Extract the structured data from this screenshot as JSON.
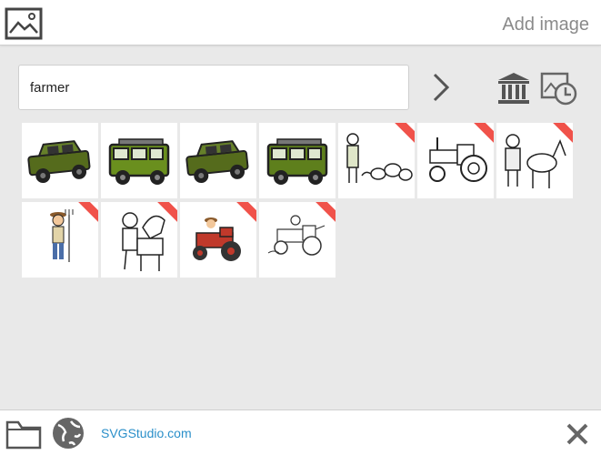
{
  "header": {
    "title": "Add image",
    "logo_icon": "image-frame-icon"
  },
  "search": {
    "value": "farmer",
    "placeholder": "",
    "go_icon": "chevron-right-icon",
    "library_icon": "library-building-icon",
    "history_icon": "image-history-clock-icon"
  },
  "results": [
    {
      "name": "green-jeep-1",
      "icon": "jeep-icon",
      "ribbon": false
    },
    {
      "name": "green-jeep-2",
      "icon": "jeep-icon",
      "ribbon": false
    },
    {
      "name": "green-jeep-3",
      "icon": "jeep-icon",
      "ribbon": false
    },
    {
      "name": "green-jeep-4",
      "icon": "jeep-icon",
      "ribbon": false
    },
    {
      "name": "farmer-with-sheep",
      "icon": "farmer-sheep-icon",
      "ribbon": true
    },
    {
      "name": "tractor-outline",
      "icon": "tractor-icon",
      "ribbon": true
    },
    {
      "name": "farmer-with-donkey",
      "icon": "farmer-donkey-icon",
      "ribbon": true
    },
    {
      "name": "farmer-with-pitchfork",
      "icon": "farmer-icon",
      "ribbon": true
    },
    {
      "name": "farmer-with-horse",
      "icon": "farmer-horse-icon",
      "ribbon": true
    },
    {
      "name": "farmer-on-red-tractor",
      "icon": "red-tractor-icon",
      "ribbon": true
    },
    {
      "name": "farmer-tractor-sketch",
      "icon": "tractor-sketch-icon",
      "ribbon": true
    }
  ],
  "footer": {
    "folder_icon": "folder-icon",
    "globe_icon": "globe-icon",
    "link_text": "SVGStudio.com",
    "close_icon": "close-icon"
  },
  "colors": {
    "background": "#e9e9e9",
    "accent_link": "#2a8fc9",
    "ribbon": "#f0524a",
    "jeep_green": "#5e7f1c"
  }
}
